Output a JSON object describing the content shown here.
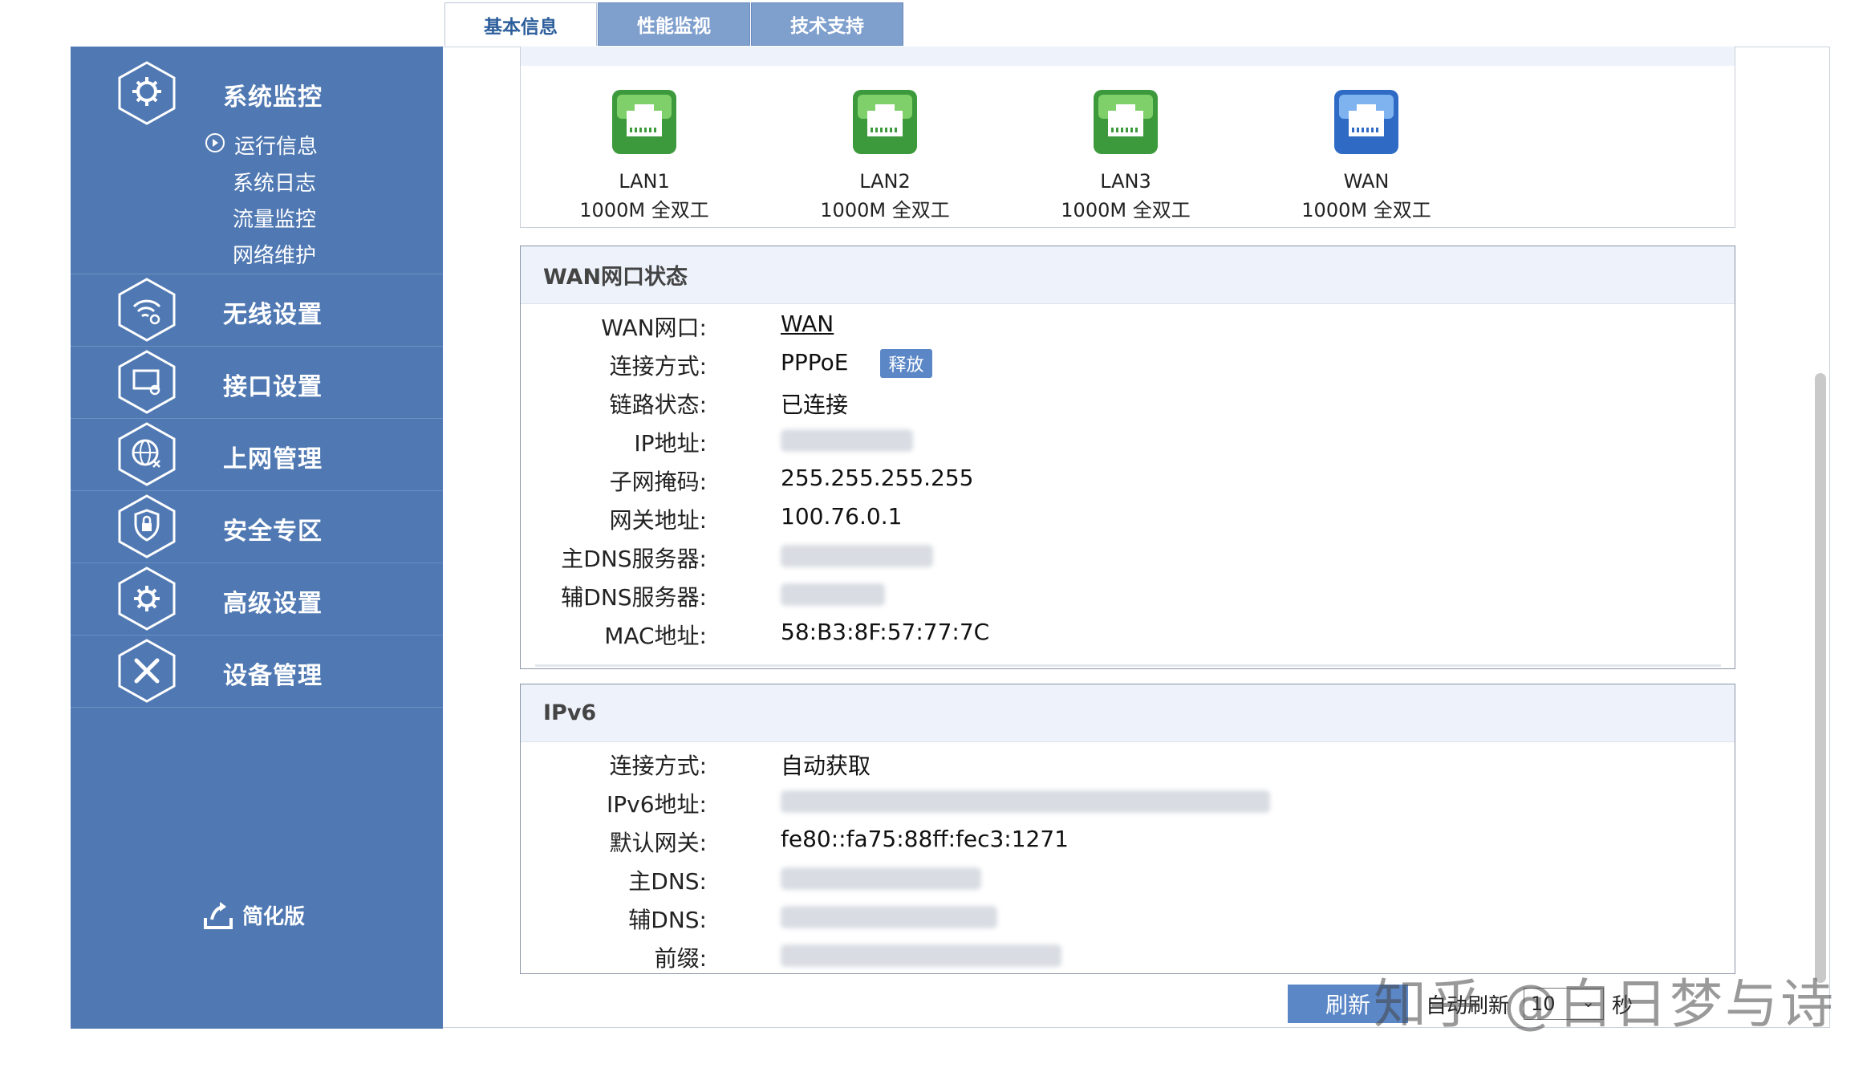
{
  "tabs": [
    {
      "label": "基本信息",
      "active": true
    },
    {
      "label": "性能监视",
      "active": false
    },
    {
      "label": "技术支持",
      "active": false
    }
  ],
  "sidebar": {
    "groups": [
      {
        "label": "系统监控",
        "icon": "gear-hand-icon",
        "items": [
          {
            "label": "运行信息",
            "selected": true
          },
          {
            "label": "系统日志"
          },
          {
            "label": "流量监控"
          },
          {
            "label": "网络维护"
          }
        ]
      },
      {
        "label": "无线设置",
        "icon": "wifi-gear-icon"
      },
      {
        "label": "接口设置",
        "icon": "interface-icon"
      },
      {
        "label": "上网管理",
        "icon": "globe-icon"
      },
      {
        "label": "安全专区",
        "icon": "shield-lock-icon"
      },
      {
        "label": "高级设置",
        "icon": "gear-icon"
      },
      {
        "label": "设备管理",
        "icon": "tools-icon"
      }
    ],
    "simplify_label": "简化版"
  },
  "ports": [
    {
      "name": "LAN1",
      "speed": "1000M 全双工",
      "color": "#3c9a3c"
    },
    {
      "name": "LAN2",
      "speed": "1000M 全双工",
      "color": "#3c9a3c"
    },
    {
      "name": "LAN3",
      "speed": "1000M 全双工",
      "color": "#3c9a3c"
    },
    {
      "name": "WAN",
      "speed": "1000M 全双工",
      "color": "#2f6bc4"
    }
  ],
  "wan": {
    "title": "WAN网口状态",
    "rows": [
      {
        "label": "WAN网口:",
        "value": "WAN"
      },
      {
        "label": "连接方式:",
        "value": "PPPoE"
      },
      {
        "label": "链路状态:",
        "value": "已连接"
      },
      {
        "label": "IP地址:",
        "value": ""
      },
      {
        "label": "子网掩码:",
        "value": "255.255.255.255"
      },
      {
        "label": "网关地址:",
        "value": "100.76.0.1"
      },
      {
        "label": "主DNS服务器:",
        "value": ""
      },
      {
        "label": "辅DNS服务器:",
        "value": ""
      },
      {
        "label": "MAC地址:",
        "value": "58:B3:8F:57:77:7C"
      }
    ],
    "release_label": "释放"
  },
  "ipv6": {
    "title": "IPv6",
    "rows": [
      {
        "label": "连接方式:",
        "value": "自动获取"
      },
      {
        "label": "IPv6地址:",
        "value": ""
      },
      {
        "label": "默认网关:",
        "value": "fe80::fa75:88ff:fec3:1271"
      },
      {
        "label": "主DNS:",
        "value": ""
      },
      {
        "label": "辅DNS:",
        "value": ""
      },
      {
        "label": "前缀:",
        "value": ""
      }
    ]
  },
  "footer": {
    "refresh_label": "刷新",
    "auto_refresh_label": "自动刷新",
    "interval_value": "10",
    "unit": "秒"
  },
  "watermark": "知乎 @白日梦与诗",
  "colors": {
    "sidebar": "#5079b3",
    "accent": "#5b87c7",
    "link": "#1a56c9"
  }
}
